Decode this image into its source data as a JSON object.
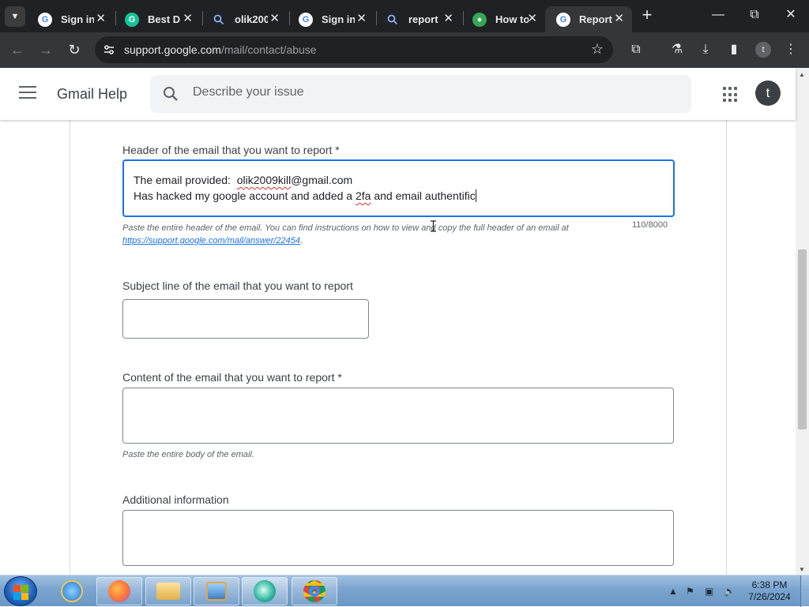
{
  "browser": {
    "tabs": [
      {
        "title": "Sign in",
        "icon": "google-g-icon",
        "active": false
      },
      {
        "title": "Best Di",
        "icon": "grammarly-icon",
        "active": false
      },
      {
        "title": "olik200",
        "icon": "search-icon",
        "active": false
      },
      {
        "title": "Sign in",
        "icon": "google-g-icon",
        "active": false
      },
      {
        "title": "report",
        "icon": "search-icon",
        "active": false
      },
      {
        "title": "How to",
        "icon": "green-site-icon",
        "active": false
      },
      {
        "title": "Report",
        "icon": "google-g-icon",
        "active": true
      }
    ],
    "url_host": "support.google.com",
    "url_path": "/mail/contact/abuse",
    "profile_initial": "t"
  },
  "header": {
    "product": "Gmail Help",
    "search_placeholder": "Describe your issue",
    "account_initial": "t"
  },
  "form": {
    "email_header": {
      "label": "Header of the email that you want to report *",
      "line1_prefix": "The email provided:  ",
      "line1_misspelled": "olik2009kill",
      "line1_suffix": "@gmail.com",
      "line2_a": "Has hacked my google account and added a ",
      "line2_misspelled": "2fa",
      "line2_b": " and email authentific",
      "hint": "Paste the entire header of the email. You can find instructions on how to view and copy the full header of an email at",
      "hint_link": "https://support.google.com/mail/answer/22454",
      "hint_end": ".",
      "counter": "110/8000"
    },
    "subject": {
      "label": "Subject line of the email that you want to report",
      "value": ""
    },
    "content": {
      "label": "Content of the email that you want to report *",
      "value": "",
      "hint": "Paste the entire body of the email."
    },
    "additional": {
      "label": "Additional information",
      "value": ""
    }
  },
  "taskbar": {
    "time": "6:38 PM",
    "date": "7/26/2024"
  },
  "colors": {
    "accent": "#1a73e8",
    "chrome_dark": "#202124",
    "chrome_toolbar": "#35363a"
  }
}
